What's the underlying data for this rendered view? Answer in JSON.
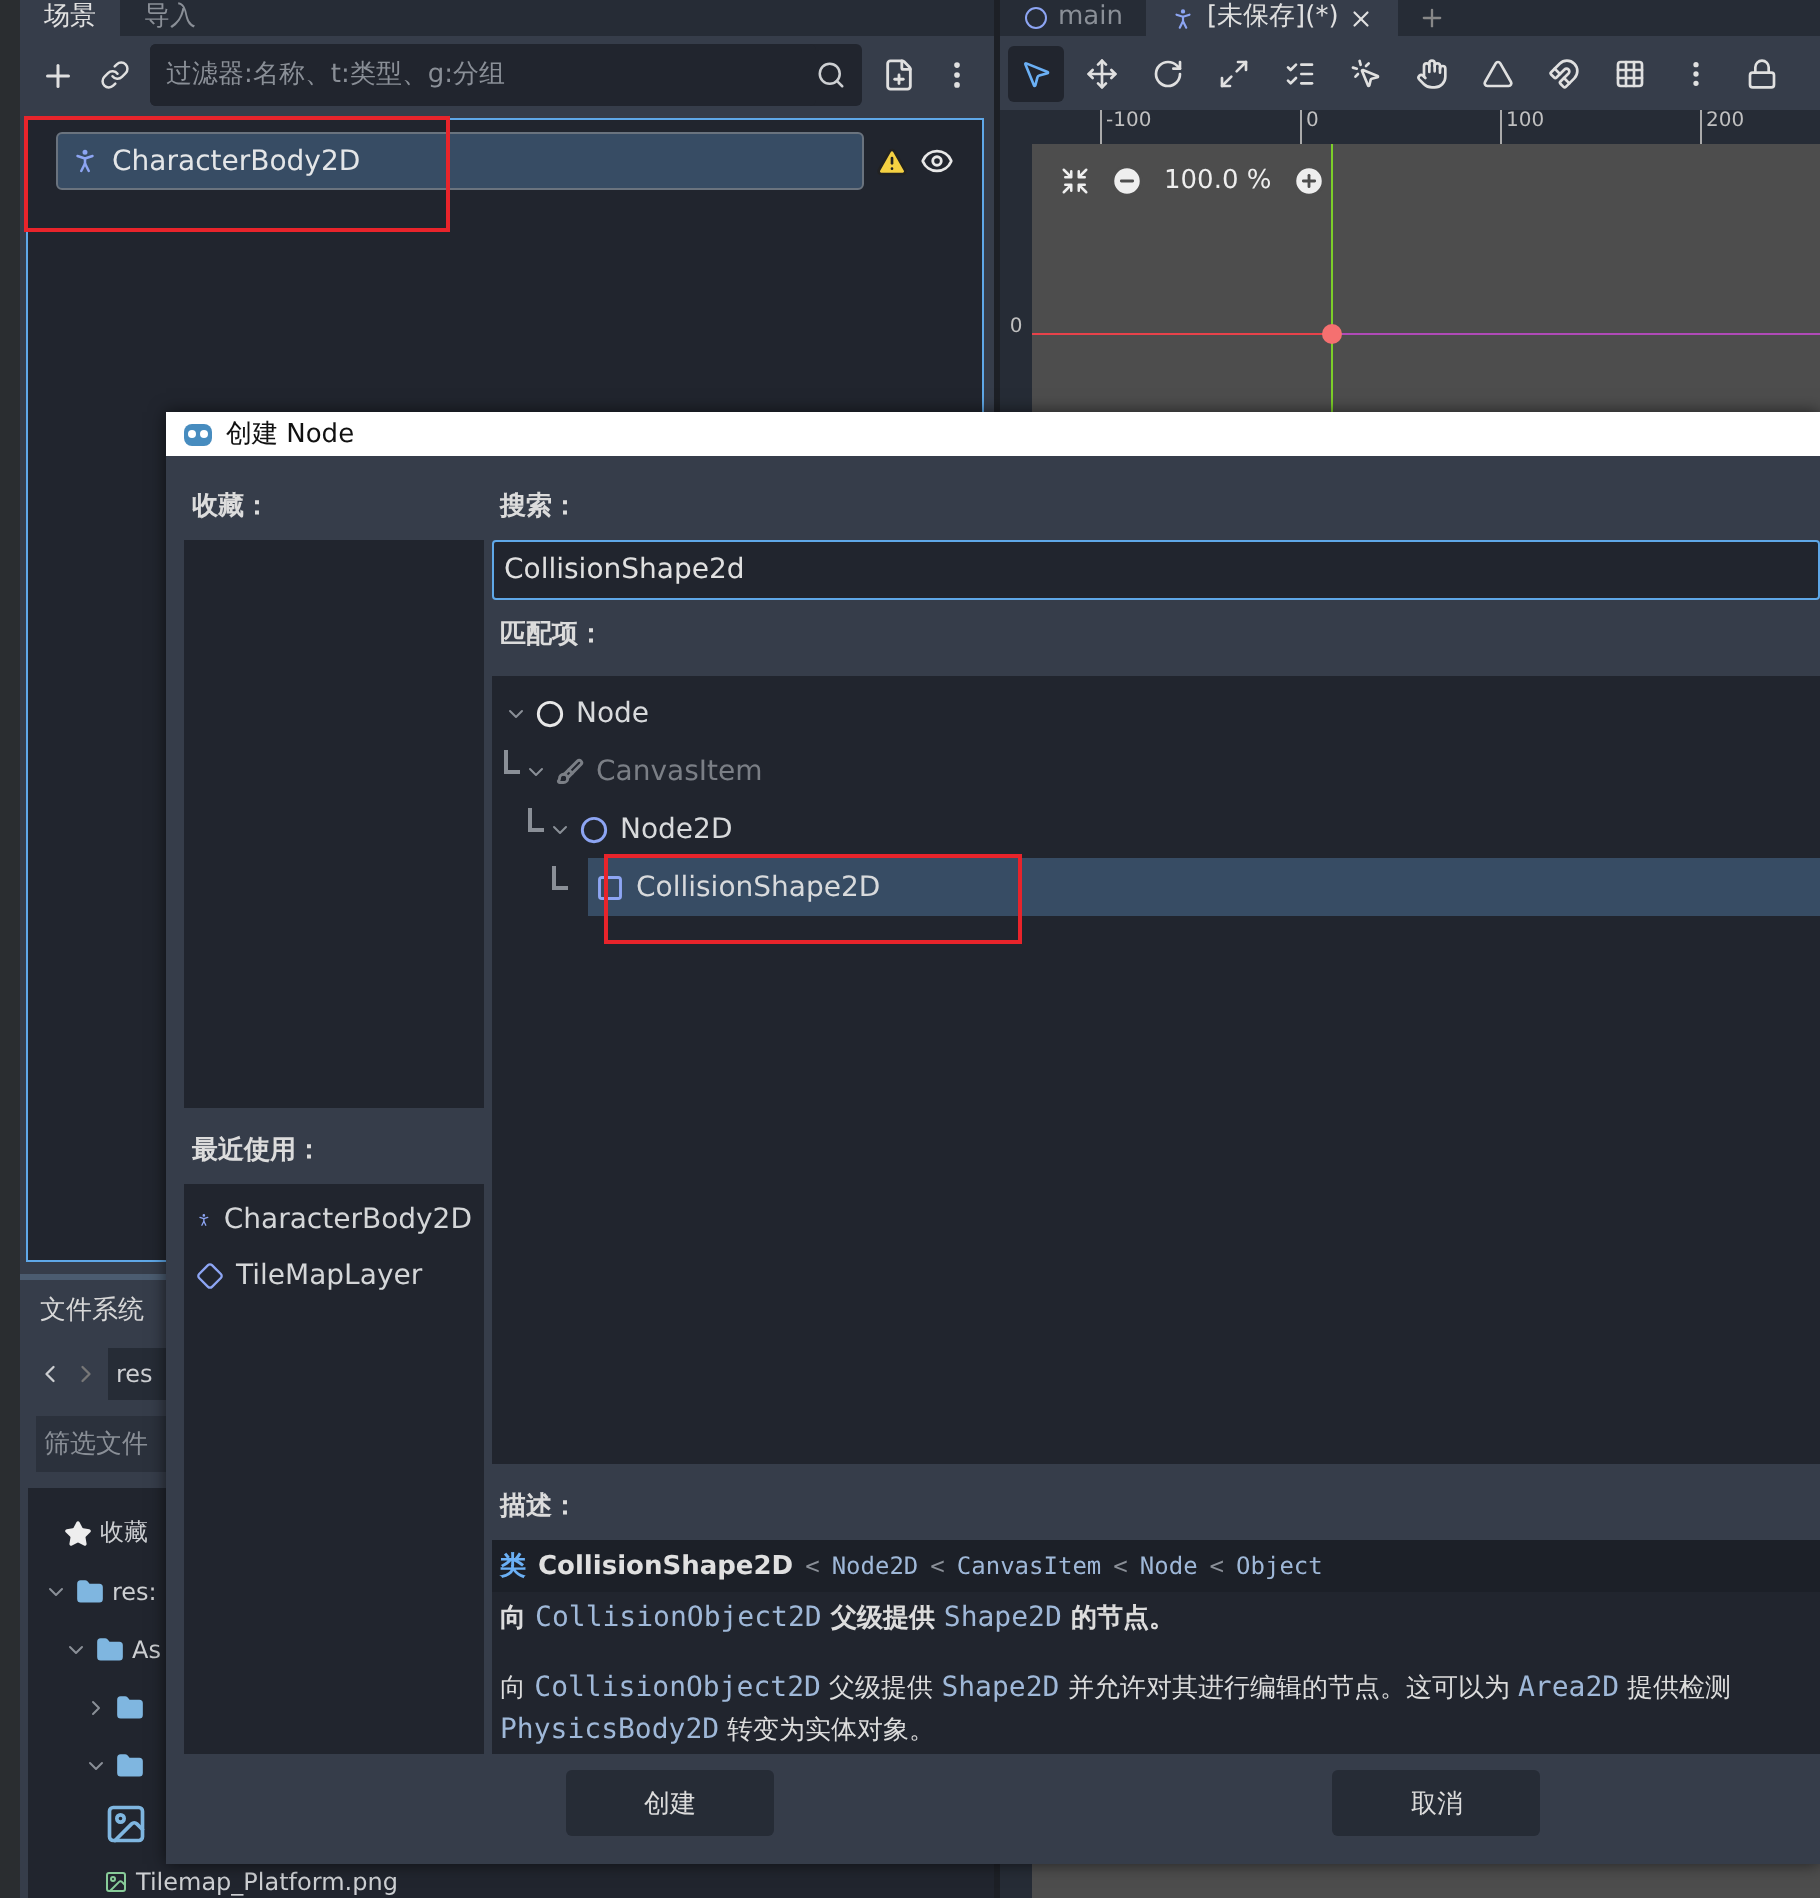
{
  "scene_dock": {
    "tabs": [
      {
        "label": "场景",
        "selected": true
      },
      {
        "label": "导入",
        "selected": false
      }
    ],
    "filter": {
      "placeholder": "过滤器:名称、t:类型、g:分组"
    },
    "tree": [
      {
        "label": "CharacterBody2D",
        "selected": true,
        "warning": true,
        "visible": true,
        "highlighted": true
      }
    ]
  },
  "filesystem_dock": {
    "title": "文件系统",
    "path": "res",
    "filter": {
      "placeholder": "筛选文件"
    },
    "tree": [
      {
        "label": "收藏",
        "kind": "favorites"
      },
      {
        "label": "res:",
        "kind": "folder",
        "expanded": true,
        "children": [
          {
            "label": "As",
            "kind": "folder",
            "expanded": true,
            "children": [
              {
                "kind": "folder",
                "expanded": false
              },
              {
                "kind": "folder",
                "expanded": true,
                "children": [
                  {
                    "kind": "thumbnail"
                  },
                  {
                    "label": "Tilemap_Platform.png",
                    "kind": "image"
                  }
                ]
              }
            ]
          }
        ]
      }
    ]
  },
  "viewport": {
    "tabs": [
      {
        "label": "main",
        "kind": "scene",
        "selected": false,
        "closable": false
      },
      {
        "label": "[未保存](*)",
        "kind": "body",
        "selected": true,
        "closable": true
      }
    ],
    "toolbar": [
      {
        "kind": "select",
        "selected": true
      },
      {
        "kind": "move",
        "selected": false
      },
      {
        "kind": "rotate",
        "selected": false
      },
      {
        "kind": "scale",
        "selected": false
      },
      {
        "kind": "list",
        "selected": false
      },
      {
        "kind": "pick",
        "selected": false
      },
      {
        "kind": "pan",
        "selected": false
      },
      {
        "kind": "ruler",
        "selected": false
      },
      {
        "kind": "snap",
        "selected": false
      },
      {
        "kind": "grid",
        "selected": false
      },
      {
        "kind": "more",
        "selected": false
      },
      {
        "kind": "lock",
        "selected": false
      }
    ],
    "ruler_labels": [
      "-100",
      "0",
      "100",
      "200"
    ],
    "vertical_ruler_label": "0",
    "zoom": "100.0 %"
  },
  "dialog": {
    "title": "创建 Node",
    "favorites_label": "收藏：",
    "recent_label": "最近使用：",
    "recent": [
      {
        "label": "CharacterBody2D",
        "kind": "body"
      },
      {
        "label": "TileMapLayer",
        "kind": "tilemap"
      }
    ],
    "search_label": "搜索：",
    "search": {
      "value": "CollisionShape2d"
    },
    "matches_label": "匹配项：",
    "matches": [
      {
        "label": "Node",
        "kind": "node",
        "expanded": true,
        "disabled": false,
        "selected": false,
        "children": [
          {
            "label": "CanvasItem",
            "kind": "canvas",
            "expanded": true,
            "disabled": true,
            "selected": false,
            "children": [
              {
                "label": "Node2D",
                "kind": "node2d",
                "expanded": true,
                "disabled": false,
                "selected": false,
                "children": [
                  {
                    "label": "CollisionShape2D",
                    "kind": "shape",
                    "disabled": false,
                    "selected": true,
                    "highlighted": true
                  }
                ]
              }
            ]
          }
        ]
      }
    ],
    "description_label": "描述：",
    "class_line": {
      "keyword": "类",
      "name": "CollisionShape2D",
      "separator": "<",
      "ancestors": [
        "Node2D",
        "CanvasItem",
        "Node",
        "Object"
      ]
    },
    "paragraphs": [
      {
        "bold": true,
        "segments": [
          {
            "text": "向 ",
            "kind": "plain"
          },
          {
            "text": "CollisionObject2D",
            "kind": "code"
          },
          {
            "text": " 父级提供 ",
            "kind": "plain"
          },
          {
            "text": "Shape2D",
            "kind": "code"
          },
          {
            "text": " 的节点。",
            "kind": "plain"
          }
        ]
      },
      {
        "bold": false,
        "segments": [
          {
            "text": "向 ",
            "kind": "plain"
          },
          {
            "text": "CollisionObject2D",
            "kind": "code"
          },
          {
            "text": " 父级提供 ",
            "kind": "plain"
          },
          {
            "text": "Shape2D",
            "kind": "code"
          },
          {
            "text": " 并允许对其进行编辑的节点。这可以为 ",
            "kind": "plain"
          },
          {
            "text": "Area2D",
            "kind": "code"
          },
          {
            "text": " 提供检测",
            "kind": "plain"
          }
        ]
      },
      {
        "bold": false,
        "segments": [
          {
            "text": "PhysicsBody2D",
            "kind": "code"
          },
          {
            "text": " 转变为实体对象。",
            "kind": "plain"
          }
        ]
      }
    ],
    "buttons": [
      "创建",
      "取消"
    ]
  }
}
